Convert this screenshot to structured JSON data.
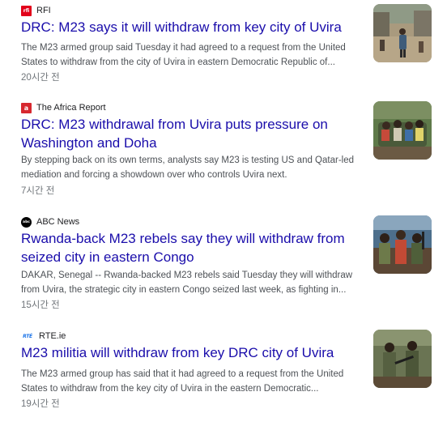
{
  "articles": [
    {
      "source": "RFI",
      "logo_text": "rfi",
      "title": "DRC: M23 says it will withdraw from key city of Uvira",
      "snippet": "The M23 armed group said Tuesday it had agreed to a request from the United States to withdraw from the city of Uvira in eastern Democratic Republic of...",
      "time": "20시간 전"
    },
    {
      "source": "The Africa Report",
      "logo_text": "a",
      "title": "DRC: M23 withdrawal from Uvira puts pressure on Washington and Doha",
      "snippet": "By stepping back on its own terms, analysts say M23 is testing US and Qatar-led mediation and forcing a showdown over who controls Uvira next.",
      "time": "7시간 전"
    },
    {
      "source": "ABC News",
      "logo_text": "abc",
      "title": "Rwanda-back M23 rebels say they will withdraw from seized city in eastern Congo",
      "snippet": "DAKAR, Senegal -- Rwanda-backed M23 rebels said Tuesday they will withdraw from Uvira, the strategic city in eastern Congo seized last week, as fighting in...",
      "time": "15시간 전"
    },
    {
      "source": "RTE.ie",
      "logo_text": "RTÉ",
      "title": "M23 militia will withdraw from key DRC city of Uvira",
      "snippet": "The M23 armed group has said that it had agreed to a request from the United States to withdraw from the key city of Uvira in the eastern Democratic...",
      "time": "19시간 전"
    }
  ],
  "colors": {
    "headline": "#1a0dab",
    "snippet": "#4d5156",
    "time": "#70757a"
  }
}
